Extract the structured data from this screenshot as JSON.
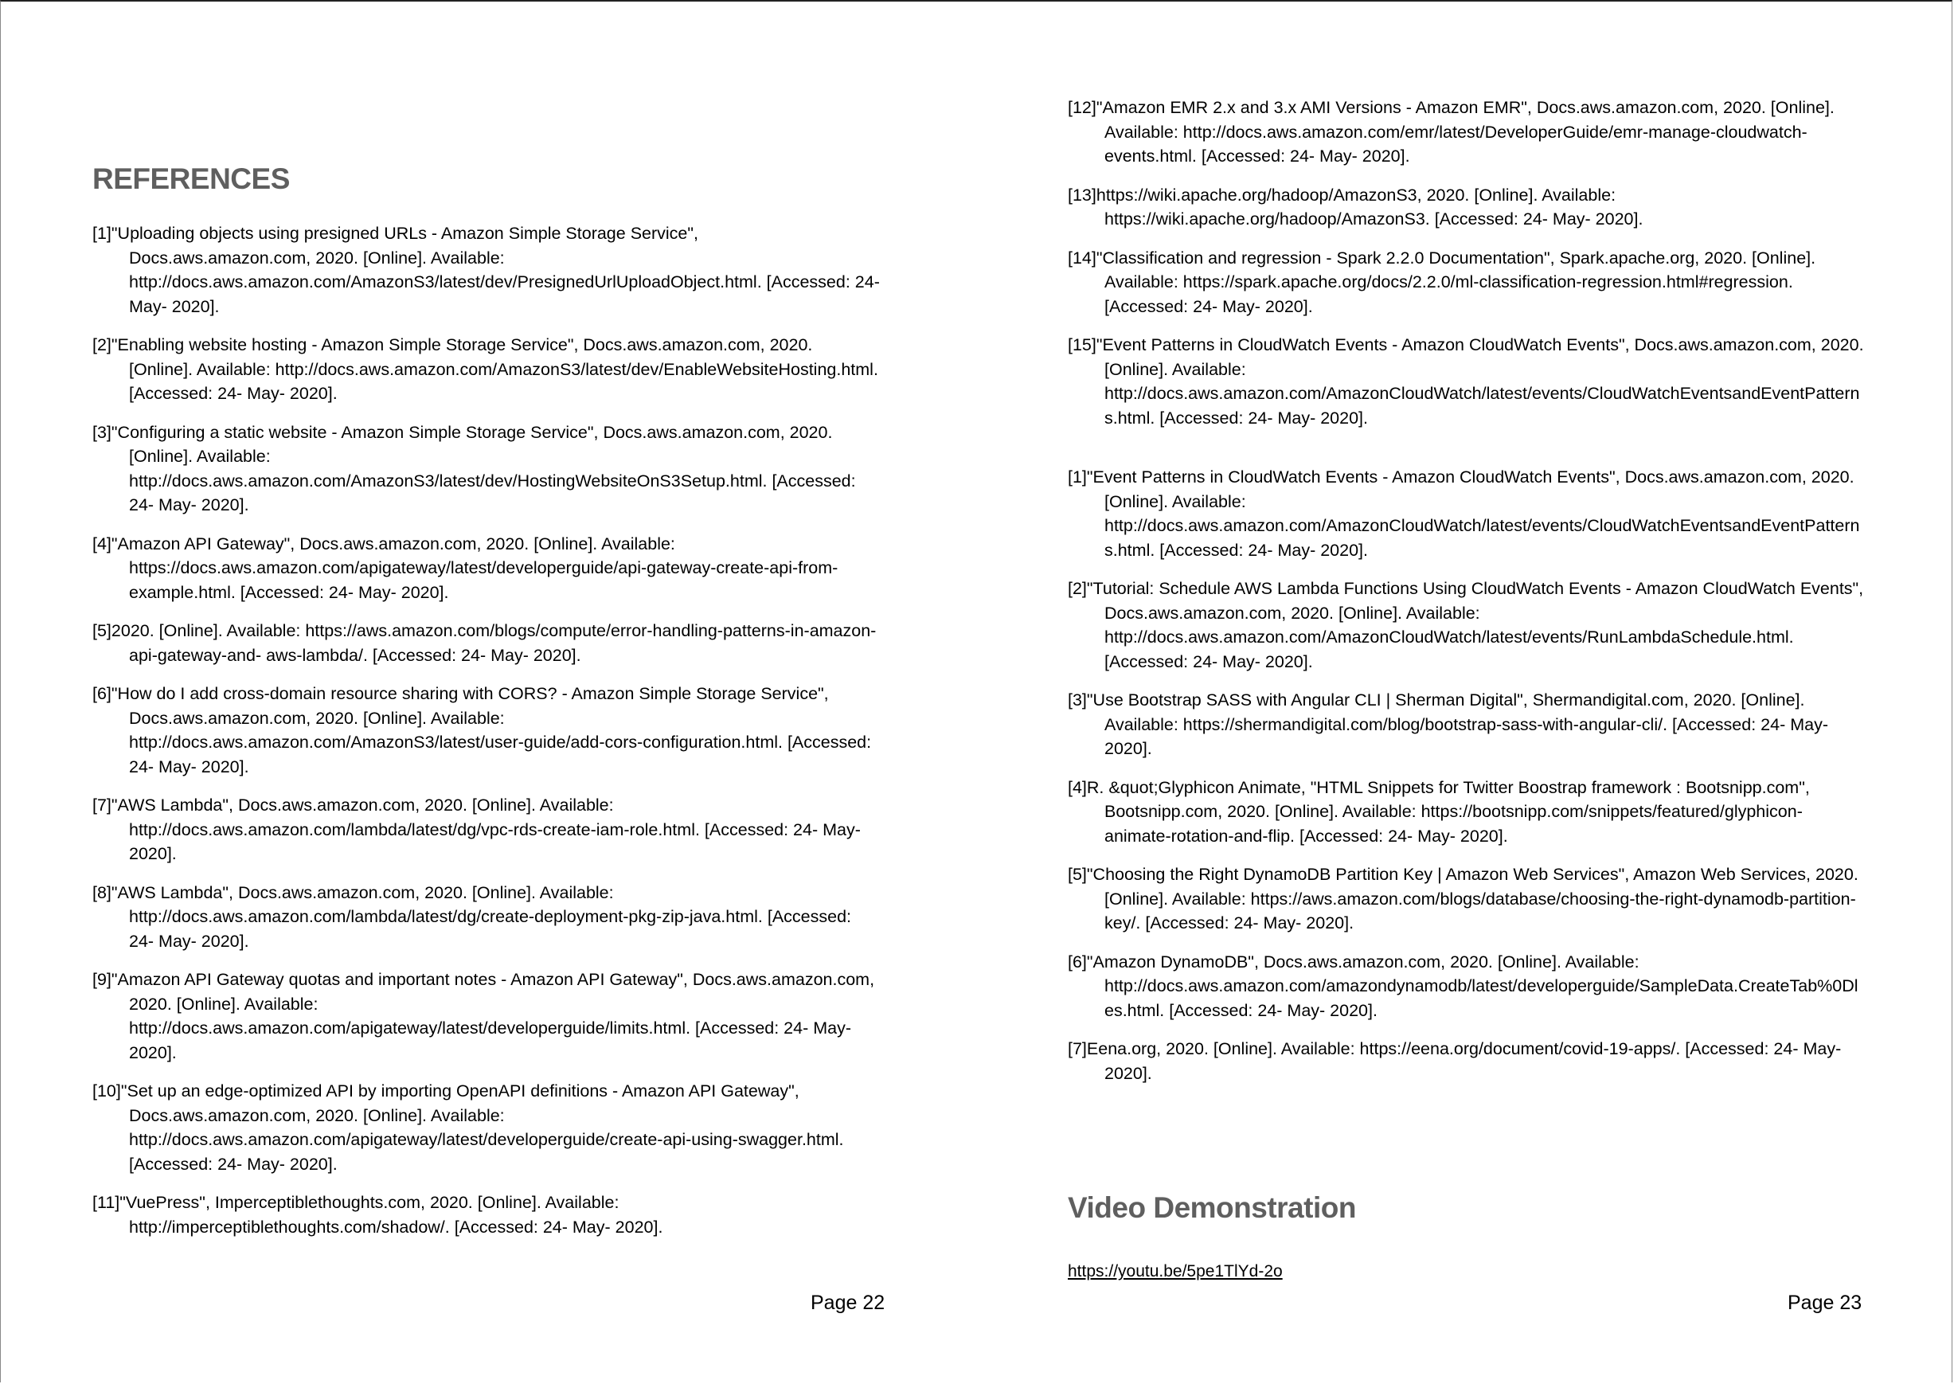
{
  "left_page": {
    "heading": "REFERENCES",
    "references": [
      "[1]\"Uploading objects using presigned URLs - Amazon Simple Storage Service\", Docs.aws.amazon.com, 2020. [Online]. Available: http://docs.aws.amazon.com/AmazonS3/latest/dev/PresignedUrlUploadObject.html. [Accessed: 24- May- 2020].",
      "[2]\"Enabling website hosting - Amazon Simple Storage Service\", Docs.aws.amazon.com, 2020. [Online]. Available: http://docs.aws.amazon.com/AmazonS3/latest/dev/EnableWebsiteHosting.html. [Accessed: 24- May- 2020].",
      "[3]\"Configuring a static website - Amazon Simple Storage Service\", Docs.aws.amazon.com, 2020. [Online]. Available: http://docs.aws.amazon.com/AmazonS3/latest/dev/HostingWebsiteOnS3Setup.html. [Accessed: 24- May- 2020].",
      "[4]\"Amazon API Gateway\", Docs.aws.amazon.com, 2020. [Online]. Available: https://docs.aws.amazon.com/apigateway/latest/developerguide/api-gateway-create-api-from- example.html. [Accessed: 24- May- 2020].",
      "[5]2020. [Online]. Available: https://aws.amazon.com/blogs/compute/error-handling-patterns-in-amazon-api-gateway-and- aws-lambda/. [Accessed: 24- May- 2020].",
      "[6]\"How do I add cross-domain resource sharing with CORS? - Amazon Simple Storage Service\", Docs.aws.amazon.com, 2020. [Online]. Available: http://docs.aws.amazon.com/AmazonS3/latest/user-guide/add-cors-configuration.html. [Accessed: 24- May- 2020].",
      "[7]\"AWS Lambda\", Docs.aws.amazon.com, 2020. [Online]. Available: http://docs.aws.amazon.com/lambda/latest/dg/vpc-rds-create-iam-role.html. [Accessed: 24- May- 2020].",
      "[8]\"AWS Lambda\", Docs.aws.amazon.com, 2020. [Online]. Available: http://docs.aws.amazon.com/lambda/latest/dg/create-deployment-pkg-zip-java.html. [Accessed: 24- May- 2020].",
      "[9]\"Amazon API Gateway quotas and important notes - Amazon API Gateway\", Docs.aws.amazon.com, 2020. [Online]. Available: http://docs.aws.amazon.com/apigateway/latest/developerguide/limits.html. [Accessed: 24- May- 2020].",
      "[10]\"Set up an edge-optimized API by importing OpenAPI definitions - Amazon API Gateway\", Docs.aws.amazon.com, 2020. [Online]. Available: http://docs.aws.amazon.com/apigateway/latest/developerguide/create-api-using-swagger.html. [Accessed: 24- May- 2020].",
      "[11]\"VuePress\", Imperceptiblethoughts.com, 2020. [Online]. Available: http://imperceptiblethoughts.com/shadow/. [Accessed: 24- May- 2020]."
    ],
    "page_number": "Page 22"
  },
  "right_page": {
    "references_continued": [
      "[12]\"Amazon EMR 2.x and 3.x AMI Versions - Amazon EMR\", Docs.aws.amazon.com, 2020. [Online]. Available: http://docs.aws.amazon.com/emr/latest/DeveloperGuide/emr-manage-cloudwatch-events.html. [Accessed: 24- May- 2020].",
      "[13]https://wiki.apache.org/hadoop/AmazonS3, 2020. [Online]. Available: https://wiki.apache.org/hadoop/AmazonS3. [Accessed: 24- May- 2020].",
      "[14]\"Classification and regression - Spark 2.2.0 Documentation\", Spark.apache.org, 2020. [Online]. Available: https://spark.apache.org/docs/2.2.0/ml-classification-regression.html#regression. [Accessed: 24- May- 2020].",
      "[15]\"Event Patterns in CloudWatch Events - Amazon CloudWatch Events\", Docs.aws.amazon.com, 2020. [Online]. Available: http://docs.aws.amazon.com/AmazonCloudWatch/latest/events/CloudWatchEventsandEventPatterns.html. [Accessed: 24- May- 2020]."
    ],
    "references_second_list": [
      "[1]\"Event Patterns in CloudWatch Events - Amazon CloudWatch Events\", Docs.aws.amazon.com, 2020. [Online]. Available: http://docs.aws.amazon.com/AmazonCloudWatch/latest/events/CloudWatchEventsandEventPatterns.html. [Accessed: 24- May- 2020].",
      "[2]\"Tutorial: Schedule AWS Lambda Functions Using CloudWatch Events - Amazon CloudWatch Events\", Docs.aws.amazon.com, 2020. [Online]. Available: http://docs.aws.amazon.com/AmazonCloudWatch/latest/events/RunLambdaSchedule.html. [Accessed: 24- May- 2020].",
      "[3]\"Use Bootstrap SASS with Angular CLI | Sherman Digital\", Shermandigital.com, 2020. [Online]. Available: https://shermandigital.com/blog/bootstrap-sass-with-angular-cli/. [Accessed: 24- May- 2020].",
      "[4]R. &quot;Glyphicon Animate, \"HTML Snippets for Twitter Boostrap framework : Bootsnipp.com\", Bootsnipp.com, 2020. [Online]. Available: https://bootsnipp.com/snippets/featured/glyphicon-animate-rotation-and-flip. [Accessed: 24- May- 2020].",
      "[5]\"Choosing the Right DynamoDB Partition Key | Amazon Web Services\", Amazon Web Services, 2020. [Online]. Available: https://aws.amazon.com/blogs/database/choosing-the-right-dynamodb-partition-key/. [Accessed: 24- May- 2020].",
      "[6]\"Amazon DynamoDB\", Docs.aws.amazon.com, 2020. [Online]. Available: http://docs.aws.amazon.com/amazondynamodb/latest/developerguide/SampleData.CreateTab%0Dles.html. [Accessed: 24- May- 2020].",
      "[7]Eena.org, 2020. [Online]. Available: https://eena.org/document/covid-19-apps/. [Accessed: 24- May- 2020]."
    ],
    "video_heading": "Video Demonstration",
    "video_link": "https://youtu.be/5pe1TlYd-2o",
    "page_number": "Page 23"
  }
}
